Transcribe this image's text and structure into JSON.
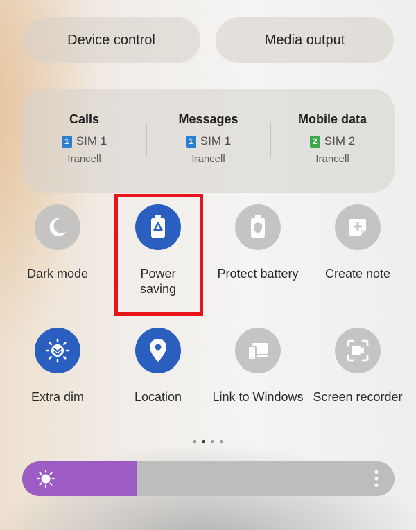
{
  "top_buttons": {
    "device_control": "Device control",
    "media_output": "Media output"
  },
  "sim_info": [
    {
      "title": "Calls",
      "sim_number": "1",
      "sim_label": "SIM 1",
      "operator": "Irancell",
      "badge_color": "#2b7fd3"
    },
    {
      "title": "Messages",
      "sim_number": "1",
      "sim_label": "SIM 1",
      "operator": "Irancell",
      "badge_color": "#2b7fd3"
    },
    {
      "title": "Mobile data",
      "sim_number": "2",
      "sim_label": "SIM 2",
      "operator": "Irancell",
      "badge_color": "#39a94a"
    }
  ],
  "tiles": [
    {
      "label": "Dark mode",
      "icon": "moon-icon",
      "active": false
    },
    {
      "label": "Power\nsaving",
      "icon": "battery-recycle-icon",
      "active": true,
      "highlighted": true
    },
    {
      "label": "Protect battery",
      "icon": "battery-shield-icon",
      "active": false
    },
    {
      "label": "Create note",
      "icon": "note-plus-icon",
      "active": false
    },
    {
      "label": "Extra dim",
      "icon": "dim-sun-icon",
      "active": true
    },
    {
      "label": "Location",
      "icon": "location-pin-icon",
      "active": true
    },
    {
      "label": "Link to Windows",
      "icon": "link-windows-icon",
      "active": false
    },
    {
      "label": "Screen recorder",
      "icon": "screen-recorder-icon",
      "active": false
    }
  ],
  "pagination": {
    "pages": 4,
    "current": 2
  },
  "brightness": {
    "level": 0.31,
    "icon": "sun-icon",
    "more_icon": "more-vertical-icon"
  },
  "colors": {
    "active_tile": "#2a5fbf",
    "inactive_tile": "#c6c4c2",
    "highlight": "#e8141b",
    "brightness_fill": "#9c5cc4",
    "brightness_track": "#bdbdbd"
  }
}
